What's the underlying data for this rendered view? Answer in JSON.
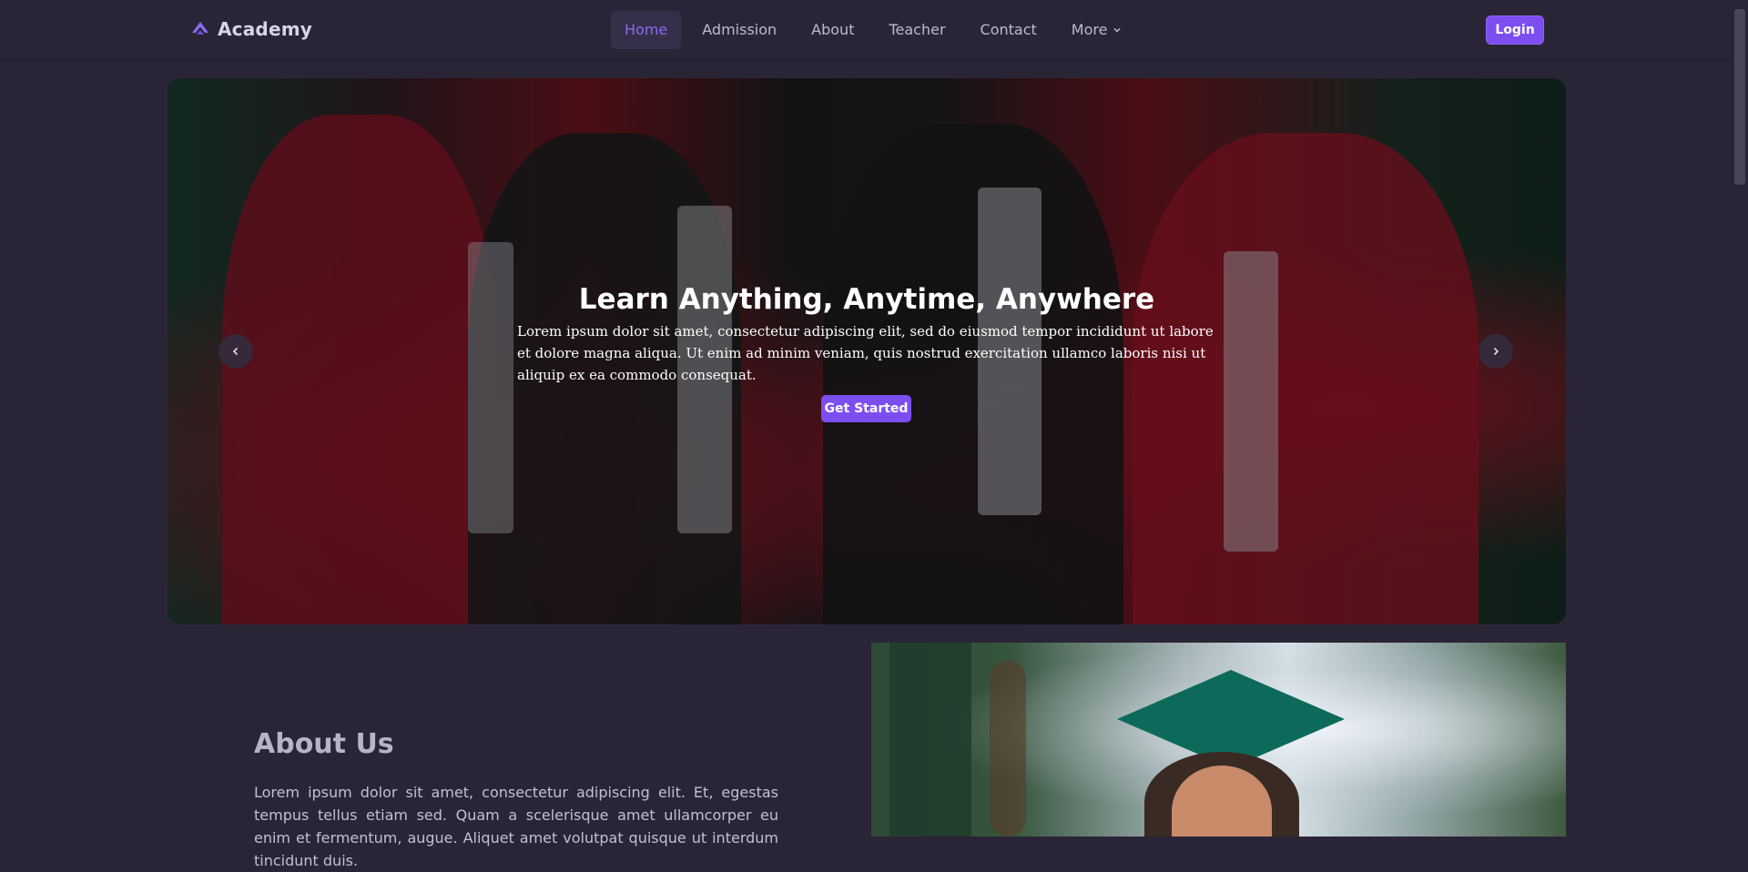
{
  "nav": {
    "brand": "Academy",
    "items": [
      {
        "label": "Home",
        "active": true
      },
      {
        "label": "Admission"
      },
      {
        "label": "About"
      },
      {
        "label": "Teacher"
      },
      {
        "label": "Contact"
      },
      {
        "label": "More"
      }
    ],
    "login_label": "Login"
  },
  "hero": {
    "title": "Learn Anything, Anytime, Anywhere",
    "text": "Lorem ipsum dolor sit amet, consectetur adipiscing elit, sed do eiusmod tempor incididunt ut labore et dolore magna aliqua. Ut enim ad minim veniam, quis nostrud exercitation ullamco laboris nisi ut aliquip ex ea commodo consequat.",
    "button_label": "Get Started"
  },
  "about": {
    "title": "About Us",
    "text": "Lorem ipsum dolor sit amet, consectetur adipiscing elit. Et, egestas tempus tellus etiam sed. Quam a scelerisque amet ullamcorper eu enim et fermentum, augue. Aliquet amet volutpat quisque ut interdum tincidunt duis."
  },
  "colors": {
    "accent": "#7c4ef0",
    "background": "#2a2536",
    "active_nav_bg": "#352f4a"
  },
  "icons": {
    "brand": "academy-logo-icon",
    "more": "chevron-down-icon",
    "carousel_prev": "chevron-left-icon",
    "carousel_next": "chevron-right-icon"
  }
}
